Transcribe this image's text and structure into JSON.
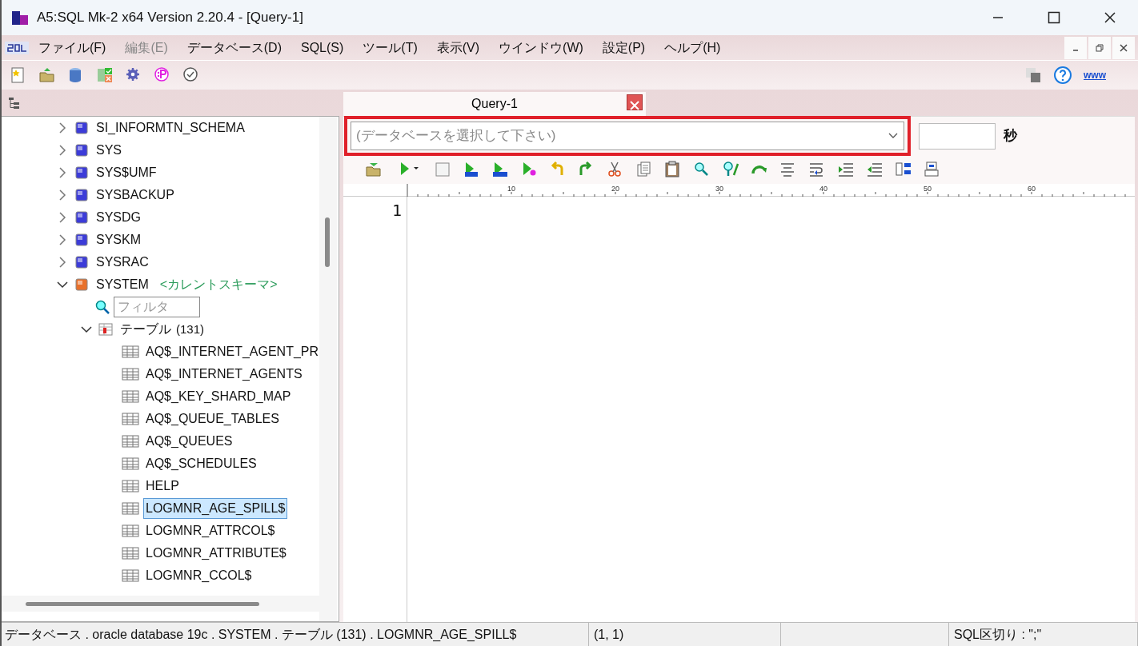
{
  "window": {
    "title": "A5:SQL Mk-2 x64 Version 2.20.4 - [Query-1]"
  },
  "menu": [
    {
      "label": "ファイル(F)",
      "disabled": false
    },
    {
      "label": "編集(E)",
      "disabled": true
    },
    {
      "label": "データベース(D)",
      "disabled": false
    },
    {
      "label": "SQL(S)",
      "disabled": false
    },
    {
      "label": "ツール(T)",
      "disabled": false
    },
    {
      "label": "表示(V)",
      "disabled": false
    },
    {
      "label": "ウインドウ(W)",
      "disabled": false
    },
    {
      "label": "設定(P)",
      "disabled": false
    },
    {
      "label": "ヘルプ(H)",
      "disabled": false
    }
  ],
  "toolbar_link": "www",
  "tree": [
    {
      "kind": "schema",
      "label": "SI_INFORMTN_SCHEMA",
      "expanded": false,
      "current": false
    },
    {
      "kind": "schema",
      "label": "SYS",
      "expanded": false,
      "current": false
    },
    {
      "kind": "schema",
      "label": "SYS$UMF",
      "expanded": false,
      "current": false
    },
    {
      "kind": "schema",
      "label": "SYSBACKUP",
      "expanded": false,
      "current": false
    },
    {
      "kind": "schema",
      "label": "SYSDG",
      "expanded": false,
      "current": false
    },
    {
      "kind": "schema",
      "label": "SYSKM",
      "expanded": false,
      "current": false
    },
    {
      "kind": "schema",
      "label": "SYSRAC",
      "expanded": false,
      "current": false
    },
    {
      "kind": "schema",
      "label": "SYSTEM",
      "expanded": true,
      "current": true,
      "note": "<カレントスキーマ>",
      "children": [
        {
          "kind": "filter",
          "placeholder": "フィルタ"
        },
        {
          "kind": "folder",
          "label": "テーブル",
          "count": "(131)",
          "expanded": true,
          "children": [
            {
              "kind": "table",
              "label": "AQ$_INTERNET_AGENT_PR",
              "selected": false
            },
            {
              "kind": "table",
              "label": "AQ$_INTERNET_AGENTS",
              "selected": false
            },
            {
              "kind": "table",
              "label": "AQ$_KEY_SHARD_MAP",
              "selected": false
            },
            {
              "kind": "table",
              "label": "AQ$_QUEUE_TABLES",
              "selected": false
            },
            {
              "kind": "table",
              "label": "AQ$_QUEUES",
              "selected": false
            },
            {
              "kind": "table",
              "label": "AQ$_SCHEDULES",
              "selected": false
            },
            {
              "kind": "table",
              "label": "HELP",
              "selected": false
            },
            {
              "kind": "table",
              "label": "LOGMNR_AGE_SPILL$",
              "selected": true
            },
            {
              "kind": "table",
              "label": "LOGMNR_ATTRCOL$",
              "selected": false
            },
            {
              "kind": "table",
              "label": "LOGMNR_ATTRIBUTE$",
              "selected": false
            },
            {
              "kind": "table",
              "label": "LOGMNR_CCOL$",
              "selected": false
            }
          ]
        }
      ]
    }
  ],
  "tabs": [
    {
      "label": "Query-1",
      "selected": true
    }
  ],
  "database_select": {
    "placeholder": "(データベースを選択して下さい)",
    "highlighted": true
  },
  "timeout": {
    "unit": "秒"
  },
  "ruler": [
    "10",
    "20",
    "30",
    "40",
    "50",
    "60"
  ],
  "editor": {
    "line_numbers": [
      "1"
    ]
  },
  "status_bar": {
    "path": "データベース . oracle database 19c . SYSTEM . テーブル (131) . LOGMNR_AGE_SPILL$",
    "position": "(1, 1)",
    "delimiter": "SQL区切り : \";\""
  }
}
